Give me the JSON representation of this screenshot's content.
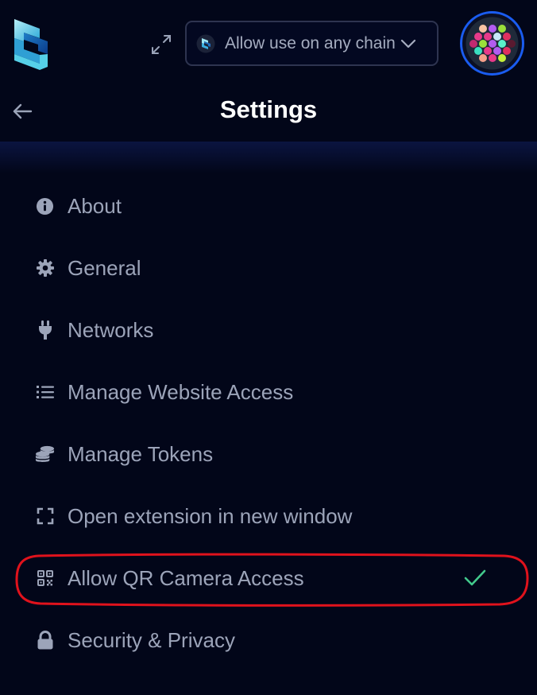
{
  "header": {
    "chain_selector": {
      "label": "Allow use on any chain"
    },
    "title": "Settings",
    "icons": {
      "logo": "brand-logo-icon",
      "expand": "expand-icon",
      "chain": "chain-logo-icon",
      "chevron": "chevron-down-icon",
      "back": "arrow-left-icon",
      "avatar": "identicon-avatar"
    }
  },
  "menu": {
    "items": [
      {
        "label": "About",
        "icon": "info-icon"
      },
      {
        "label": "General",
        "icon": "gear-icon"
      },
      {
        "label": "Networks",
        "icon": "plug-icon"
      },
      {
        "label": "Manage Website Access",
        "icon": "list-icon"
      },
      {
        "label": "Manage Tokens",
        "icon": "coins-icon"
      },
      {
        "label": "Open extension in new window",
        "icon": "expand-frame-icon"
      },
      {
        "label": "Allow QR Camera Access",
        "icon": "qr-code-icon",
        "checked": true
      },
      {
        "label": "Security & Privacy",
        "icon": "lock-icon"
      }
    ]
  },
  "colors": {
    "background": "#020619",
    "text": "#9ca4b9",
    "title": "#ffffff",
    "check": "#42c98c",
    "avatar_border": "#1a5cf0",
    "highlight_annotation": "#e0121c"
  }
}
